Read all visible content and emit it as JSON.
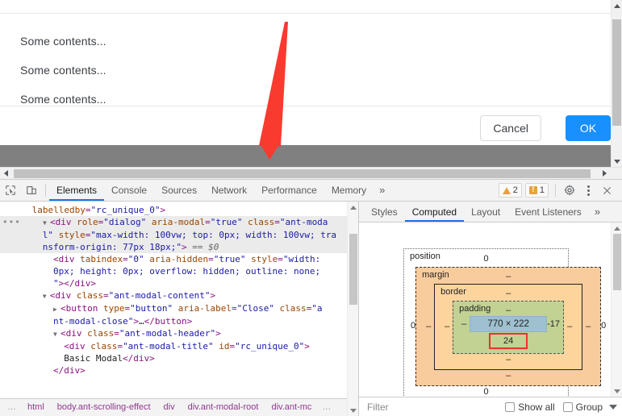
{
  "page": {
    "modal": {
      "body_lines": [
        "Some contents...",
        "Some contents...",
        "Some contents..."
      ],
      "cancel_label": "Cancel",
      "ok_label": "OK",
      "accent_color": "#1890ff"
    },
    "annotation": {
      "arrow_color": "#f93a2f",
      "name": "red-down-arrow"
    }
  },
  "devtools": {
    "toolbar": {
      "inspect_icon": "inspect-element-icon",
      "device_icon": "device-toolbar-icon",
      "tabs": [
        {
          "label": "Elements",
          "active": true
        },
        {
          "label": "Console",
          "active": false
        },
        {
          "label": "Sources",
          "active": false
        },
        {
          "label": "Network",
          "active": false
        },
        {
          "label": "Performance",
          "active": false
        },
        {
          "label": "Memory",
          "active": false
        }
      ],
      "more_tabs": "»",
      "warnings_count": "2",
      "issues_count": "1",
      "settings_icon": "gear-icon",
      "menu_icon": "kebab-menu-icon",
      "close_icon": "close-icon"
    },
    "dom_tree": {
      "rows": [
        {
          "indent": 6,
          "selected": false,
          "gutter": "",
          "parts": [
            {
              "t": "attr",
              "s": "labelledby"
            },
            {
              "t": "punct",
              "s": "="
            },
            {
              "t": "val",
              "s": "\"rc_unique_0\""
            },
            {
              "t": "tag",
              "s": ">"
            }
          ]
        },
        {
          "indent": 0,
          "selected": true,
          "gutter": "•••",
          "parts": [
            {
              "t": "sp",
              "s": "        "
            },
            {
              "t": "tri",
              "s": "▼"
            },
            {
              "t": "tag",
              "s": "<div"
            },
            {
              "t": "attr",
              "s": " role"
            },
            {
              "t": "punct",
              "s": "="
            },
            {
              "t": "val",
              "s": "\"dialog\""
            },
            {
              "t": "attr",
              "s": " aria-modal"
            },
            {
              "t": "punct",
              "s": "="
            },
            {
              "t": "val",
              "s": "\"true\""
            },
            {
              "t": "attr",
              "s": " class"
            },
            {
              "t": "punct",
              "s": "="
            },
            {
              "t": "val",
              "s": "\"ant-moda"
            }
          ]
        },
        {
          "indent": 8,
          "selected": true,
          "gutter": "",
          "parts": [
            {
              "t": "val",
              "s": "l\""
            },
            {
              "t": "attr",
              "s": " style"
            },
            {
              "t": "punct",
              "s": "="
            },
            {
              "t": "val",
              "s": "\"max-width: 100vw; top: 0px; width: 100vw; tra"
            }
          ]
        },
        {
          "indent": 8,
          "selected": true,
          "gutter": "",
          "parts": [
            {
              "t": "val",
              "s": "nsform-origin: 77px 18px;\""
            },
            {
              "t": "tag",
              "s": ">"
            },
            {
              "t": "dollar",
              "s": " == $0"
            }
          ]
        },
        {
          "indent": 10,
          "selected": false,
          "gutter": "",
          "parts": [
            {
              "t": "tag",
              "s": "<div"
            },
            {
              "t": "attr",
              "s": " tabindex"
            },
            {
              "t": "punct",
              "s": "="
            },
            {
              "t": "val",
              "s": "\"0\""
            },
            {
              "t": "attr",
              "s": " aria-hidden"
            },
            {
              "t": "punct",
              "s": "="
            },
            {
              "t": "val",
              "s": "\"true\""
            },
            {
              "t": "attr",
              "s": " style"
            },
            {
              "t": "punct",
              "s": "="
            },
            {
              "t": "val",
              "s": "\"width:"
            }
          ]
        },
        {
          "indent": 10,
          "selected": false,
          "gutter": "",
          "parts": [
            {
              "t": "val",
              "s": "0px; height: 0px; overflow: hidden; outline: none;"
            }
          ]
        },
        {
          "indent": 10,
          "selected": false,
          "gutter": "",
          "parts": [
            {
              "t": "val",
              "s": "\""
            },
            {
              "t": "tag",
              "s": "></div>"
            }
          ]
        },
        {
          "indent": 8,
          "selected": false,
          "gutter": "",
          "parts": [
            {
              "t": "tri",
              "s": "▼"
            },
            {
              "t": "tag",
              "s": "<div"
            },
            {
              "t": "attr",
              "s": " class"
            },
            {
              "t": "punct",
              "s": "="
            },
            {
              "t": "val",
              "s": "\"ant-modal-content\""
            },
            {
              "t": "tag",
              "s": ">"
            }
          ]
        },
        {
          "indent": 10,
          "selected": false,
          "gutter": "",
          "parts": [
            {
              "t": "tri",
              "s": "▶"
            },
            {
              "t": "tag",
              "s": "<button"
            },
            {
              "t": "attr",
              "s": " type"
            },
            {
              "t": "punct",
              "s": "="
            },
            {
              "t": "val",
              "s": "\"button\""
            },
            {
              "t": "attr",
              "s": " aria-label"
            },
            {
              "t": "punct",
              "s": "="
            },
            {
              "t": "val",
              "s": "\"Close\""
            },
            {
              "t": "attr",
              "s": " class"
            },
            {
              "t": "punct",
              "s": "="
            },
            {
              "t": "val",
              "s": "\"a"
            }
          ]
        },
        {
          "indent": 10,
          "selected": false,
          "gutter": "",
          "parts": [
            {
              "t": "val",
              "s": "nt-modal-close\""
            },
            {
              "t": "tag",
              "s": ">"
            },
            {
              "t": "txt",
              "s": "…"
            },
            {
              "t": "tag",
              "s": "</button>"
            }
          ]
        },
        {
          "indent": 10,
          "selected": false,
          "gutter": "",
          "parts": [
            {
              "t": "tri",
              "s": "▼"
            },
            {
              "t": "tag",
              "s": "<div"
            },
            {
              "t": "attr",
              "s": " class"
            },
            {
              "t": "punct",
              "s": "="
            },
            {
              "t": "val",
              "s": "\"ant-modal-header\""
            },
            {
              "t": "tag",
              "s": ">"
            }
          ]
        },
        {
          "indent": 12,
          "selected": false,
          "gutter": "",
          "parts": [
            {
              "t": "tag",
              "s": "<div"
            },
            {
              "t": "attr",
              "s": " class"
            },
            {
              "t": "punct",
              "s": "="
            },
            {
              "t": "val",
              "s": "\"ant-modal-title\""
            },
            {
              "t": "attr",
              "s": " id"
            },
            {
              "t": "punct",
              "s": "="
            },
            {
              "t": "val",
              "s": "\"rc_unique_0\""
            },
            {
              "t": "tag",
              "s": ">"
            }
          ]
        },
        {
          "indent": 12,
          "selected": false,
          "gutter": "",
          "parts": [
            {
              "t": "txt",
              "s": "Basic Modal"
            },
            {
              "t": "tag",
              "s": "</div>"
            }
          ]
        },
        {
          "indent": 10,
          "selected": false,
          "gutter": "",
          "parts": [
            {
              "t": "tag",
              "s": "</div>"
            }
          ]
        }
      ],
      "breadcrumbs": [
        "…",
        "html",
        "body.ant-scrolling-effect",
        "div",
        "div.ant-modal-root",
        "div.ant-mc",
        "…"
      ]
    },
    "styles_panel": {
      "tabs": [
        {
          "label": "Styles",
          "active": false
        },
        {
          "label": "Computed",
          "active": true
        },
        {
          "label": "Layout",
          "active": false
        },
        {
          "label": "Event Listeners",
          "active": false
        }
      ],
      "more_tabs": "»",
      "box_model": {
        "position_label": "position",
        "position_top": "0",
        "position_left": "0",
        "position_right": "0",
        "position_bottom": "0",
        "margin_label": "margin",
        "margin_top": "–",
        "margin_left": "–",
        "margin_right": "–",
        "margin_bottom": "–",
        "border_label": "border",
        "border_top": "–",
        "border_left": "–",
        "border_right": "–",
        "border_bottom": "–",
        "padding_label": "padding",
        "padding_top": "–",
        "padding_left": "–",
        "padding_right": "-17",
        "padding_bottom": "24",
        "content_size": "770 × 222",
        "highlight_color": "#e8342a"
      },
      "filter": {
        "placeholder": "Filter",
        "value": "",
        "show_all_label": "Show all",
        "group_label": "Group",
        "show_all_checked": false,
        "group_checked": false,
        "caret_icon": "chevron-down-icon"
      }
    }
  }
}
